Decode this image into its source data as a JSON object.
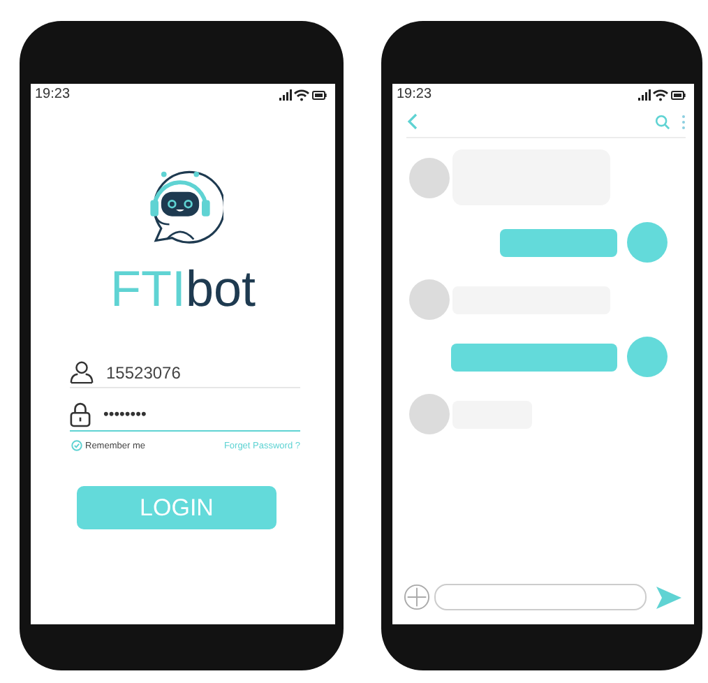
{
  "login_screen": {
    "status_bar": {
      "time": "19:23"
    },
    "logo": {
      "prefix": "FTI",
      "suffix": "bot"
    },
    "username": {
      "value": "15523076"
    },
    "password": {
      "value": "••••••••",
      "focused": true
    },
    "remember_me": {
      "label": "Remember me",
      "checked": true
    },
    "forgot_link": "Forget Password ?",
    "login_button": "LOGIN"
  },
  "chat_screen": {
    "status_bar": {
      "time": "19:23"
    },
    "messages": [
      {
        "kind": "incoming"
      },
      {
        "kind": "outgoing"
      },
      {
        "kind": "incoming"
      },
      {
        "kind": "outgoing"
      },
      {
        "kind": "incoming"
      }
    ]
  }
}
